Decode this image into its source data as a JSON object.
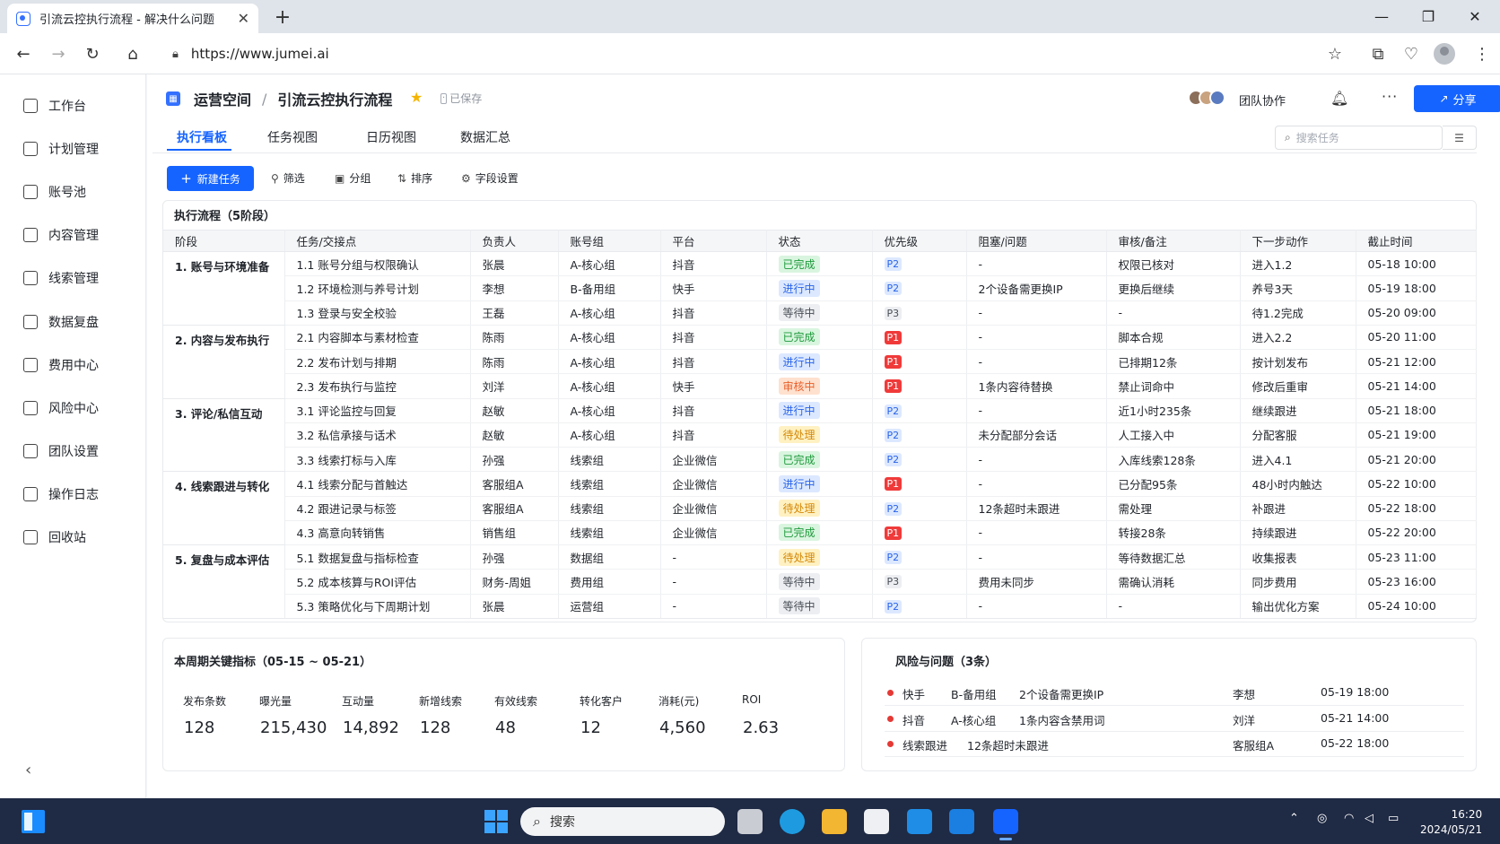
{
  "browser": {
    "tab_title": "引流云控执行流程 - 解决什么问题",
    "url": "https://www.jumei.ai"
  },
  "sidebar": {
    "items": [
      {
        "label": "工作台",
        "icon": "dashboard-icon"
      },
      {
        "label": "计划管理",
        "icon": "calendar-check-icon"
      },
      {
        "label": "账号池",
        "icon": "cube-icon"
      },
      {
        "label": "内容管理",
        "icon": "document-check-icon"
      },
      {
        "label": "线索管理",
        "icon": "list-icon"
      },
      {
        "label": "数据复盘",
        "icon": "trend-icon"
      },
      {
        "label": "费用中心",
        "icon": "wallet-icon"
      },
      {
        "label": "风险中心",
        "icon": "shield-icon"
      },
      {
        "label": "团队设置",
        "icon": "users-icon"
      },
      {
        "label": "操作日志",
        "icon": "log-icon"
      },
      {
        "label": "回收站",
        "icon": "trash-icon"
      }
    ]
  },
  "header": {
    "workspace": "运营空间",
    "separator": "/",
    "page_title": "引流云控执行流程",
    "saved": "已保存",
    "team_label": "团队协作",
    "share_label": "分享"
  },
  "tabs": [
    "执行看板",
    "任务视图",
    "日历视图",
    "数据汇总"
  ],
  "search": {
    "placeholder": "搜索任务"
  },
  "toolbar": {
    "new_task": "新建任务",
    "filter": "筛选",
    "group": "分组",
    "sort": "排序",
    "fields": "字段设置"
  },
  "table": {
    "title": "执行流程（5阶段）",
    "columns": [
      "阶段",
      "任务/交接点",
      "负责人",
      "账号组",
      "平台",
      "状态",
      "优先级",
      "阻塞/问题",
      "审核/备注",
      "下一步动作",
      "截止时间"
    ],
    "stages": [
      {
        "name": "1. 账号与环境准备",
        "rows": [
          [
            "1.1 账号分组与权限确认",
            "张晨",
            "A-核心组",
            "抖音",
            "已完成",
            "P2",
            "-",
            "权限已核对",
            "进入1.2",
            "05-18 10:00"
          ],
          [
            "1.2 环境检测与养号计划",
            "李想",
            "B-备用组",
            "快手",
            "进行中",
            "P2",
            "2个设备需更换IP",
            "更换后继续",
            "养号3天",
            "05-19 18:00"
          ],
          [
            "1.3 登录与安全校验",
            "王磊",
            "A-核心组",
            "抖音",
            "等待中",
            "P3",
            "-",
            "-",
            "待1.2完成",
            "05-20 09:00"
          ]
        ]
      },
      {
        "name": "2. 内容与发布执行",
        "rows": [
          [
            "2.1 内容脚本与素材检查",
            "陈雨",
            "A-核心组",
            "抖音",
            "已完成",
            "P1",
            "-",
            "脚本合规",
            "进入2.2",
            "05-20 11:00"
          ],
          [
            "2.2 发布计划与排期",
            "陈雨",
            "A-核心组",
            "抖音",
            "进行中",
            "P1",
            "-",
            "已排期12条",
            "按计划发布",
            "05-21 12:00"
          ],
          [
            "2.3 发布执行与监控",
            "刘洋",
            "A-核心组",
            "快手",
            "审核中",
            "P1",
            "1条内容待替换",
            "禁止词命中",
            "修改后重审",
            "05-21 14:00"
          ]
        ]
      },
      {
        "name": "3. 评论/私信互动",
        "rows": [
          [
            "3.1 评论监控与回复",
            "赵敏",
            "A-核心组",
            "抖音",
            "进行中",
            "P2",
            "-",
            "近1小时235条",
            "继续跟进",
            "05-21 18:00"
          ],
          [
            "3.2 私信承接与话术",
            "赵敏",
            "A-核心组",
            "抖音",
            "待处理",
            "P2",
            "未分配部分会话",
            "人工接入中",
            "分配客服",
            "05-21 19:00"
          ],
          [
            "3.3 线索打标与入库",
            "孙强",
            "线索组",
            "企业微信",
            "已完成",
            "P2",
            "-",
            "入库线索128条",
            "进入4.1",
            "05-21 20:00"
          ]
        ]
      },
      {
        "name": "4. 线索跟进与转化",
        "rows": [
          [
            "4.1 线索分配与首触达",
            "客服组A",
            "线索组",
            "企业微信",
            "进行中",
            "P1",
            "-",
            "已分配95条",
            "48小时内触达",
            "05-22 10:00"
          ],
          [
            "4.2 跟进记录与标签",
            "客服组A",
            "线索组",
            "企业微信",
            "待处理",
            "P2",
            "12条超时未跟进",
            "需处理",
            "补跟进",
            "05-22 18:00"
          ],
          [
            "4.3 高意向转销售",
            "销售组",
            "线索组",
            "企业微信",
            "已完成",
            "P1",
            "-",
            "转接28条",
            "持续跟进",
            "05-22 20:00"
          ]
        ]
      },
      {
        "name": "5. 复盘与成本评估",
        "rows": [
          [
            "5.1 数据复盘与指标检查",
            "孙强",
            "数据组",
            "-",
            "待处理",
            "P2",
            "-",
            "等待数据汇总",
            "收集报表",
            "05-23 11:00"
          ],
          [
            "5.2 成本核算与ROI评估",
            "财务-周姐",
            "费用组",
            "-",
            "等待中",
            "P3",
            "费用未同步",
            "需确认消耗",
            "同步费用",
            "05-23 16:00"
          ],
          [
            "5.3 策略优化与下周期计划",
            "张晨",
            "运营组",
            "-",
            "等待中",
            "P2",
            "-",
            "-",
            "输出优化方案",
            "05-24 10:00"
          ]
        ]
      }
    ]
  },
  "status_colors": {
    "已完成": {
      "bg": "#d9f5df",
      "fg": "#1f9a3c"
    },
    "进行中": {
      "bg": "#dce8ff",
      "fg": "#2a64e8"
    },
    "等待中": {
      "bg": "#eceef1",
      "fg": "#4a4f57"
    },
    "审核中": {
      "bg": "#ffe1cf",
      "fg": "#e8612c"
    },
    "待处理": {
      "bg": "#fff1c2",
      "fg": "#d48806"
    }
  },
  "priority_colors": {
    "P1": {
      "bg": "#f03a3a",
      "fg": "#ffffff"
    },
    "P2": {
      "bg": "#dce8ff",
      "fg": "#2a64e8"
    },
    "P3": {
      "bg": "#eceef1",
      "fg": "#4a4f57"
    }
  },
  "kpi": {
    "title": "本周期关键指标（05-15 ~ 05-21）",
    "items": [
      {
        "label": "发布条数",
        "value": "128"
      },
      {
        "label": "曝光量",
        "value": "215,430"
      },
      {
        "label": "互动量",
        "value": "14,892"
      },
      {
        "label": "新增线索",
        "value": "128"
      },
      {
        "label": "有效线索",
        "value": "48"
      },
      {
        "label": "转化客户",
        "value": "12"
      },
      {
        "label": "消耗(元)",
        "value": "4,560"
      },
      {
        "label": "ROI",
        "value": "2.63"
      }
    ]
  },
  "risks": {
    "title": "风险与问题（3条）",
    "items": [
      {
        "channel": "快手",
        "group": "B-备用组",
        "issue": "2个设备需更换IP",
        "owner": "李想",
        "time": "05-19 18:00"
      },
      {
        "channel": "抖音",
        "group": "A-核心组",
        "issue": "1条内容含禁用词",
        "owner": "刘洋",
        "time": "05-21 14:00"
      },
      {
        "channel": "线索跟进",
        "group": "",
        "issue": "12条超时未跟进",
        "owner": "客服组A",
        "time": "05-22 18:00"
      }
    ]
  },
  "taskbar": {
    "search_placeholder": "搜索",
    "time": "16:20",
    "date": "2024/05/21"
  }
}
